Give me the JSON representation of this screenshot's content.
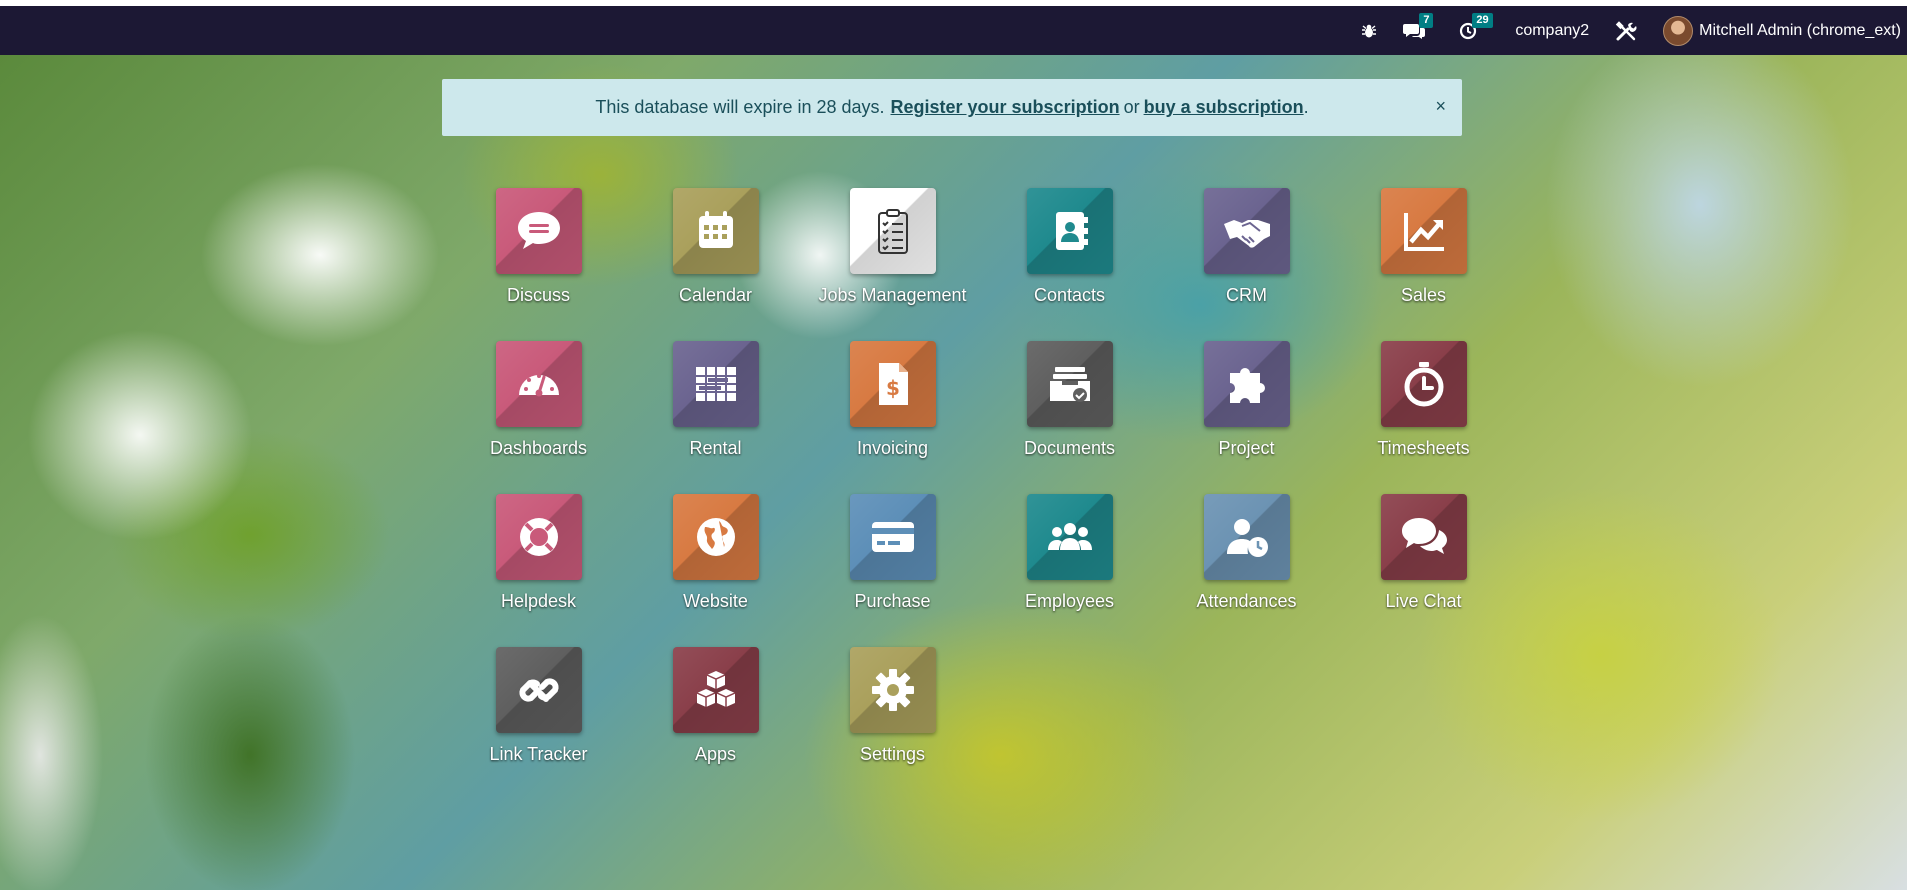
{
  "navbar": {
    "debug_icon": "bug-icon",
    "messages_count": "7",
    "activities_count": "29",
    "company": "company2",
    "tools_icon": "tools-icon",
    "user_name": "Mitchell Admin (chrome_ext)",
    "background_color": "#1c1834",
    "badge_color": "#017e84"
  },
  "notice": {
    "text_before": "This database will expire in 28 days.",
    "register_link": "Register your subscription",
    "or_text": "or",
    "buy_link": "buy a subscription",
    "end_text": ".",
    "close_label": "×",
    "background_color": "#cde8ec"
  },
  "apps": [
    {
      "label": "Discuss",
      "icon": "chat-bubble-icon",
      "color": "#c95a7a"
    },
    {
      "label": "Calendar",
      "icon": "calendar-icon",
      "color": "#aaa05c"
    },
    {
      "label": "Jobs Management",
      "icon": "clipboard-checklist-icon",
      "color": "#ffffff"
    },
    {
      "label": "Contacts",
      "icon": "address-book-icon",
      "color": "#1f8a8e"
    },
    {
      "label": "CRM",
      "icon": "handshake-icon",
      "color": "#6b6490"
    },
    {
      "label": "Sales",
      "icon": "trending-chart-icon",
      "color": "#d87a42"
    },
    {
      "label": "Dashboards",
      "icon": "gauge-icon",
      "color": "#c95a7a"
    },
    {
      "label": "Rental",
      "icon": "table-grid-icon",
      "color": "#6b6490"
    },
    {
      "label": "Invoicing",
      "icon": "invoice-dollar-icon",
      "color": "#d87a42"
    },
    {
      "label": "Documents",
      "icon": "inbox-tray-icon",
      "color": "#5f5f5f"
    },
    {
      "label": "Project",
      "icon": "puzzle-icon",
      "color": "#6b6490"
    },
    {
      "label": "Timesheets",
      "icon": "stopwatch-icon",
      "color": "#8a3f4a"
    },
    {
      "label": "Helpdesk",
      "icon": "lifebuoy-icon",
      "color": "#c95a7a"
    },
    {
      "label": "Website",
      "icon": "globe-icon",
      "color": "#d87a42"
    },
    {
      "label": "Purchase",
      "icon": "credit-card-icon",
      "color": "#5d8fb8"
    },
    {
      "label": "Employees",
      "icon": "people-group-icon",
      "color": "#1f8a8e"
    },
    {
      "label": "Attendances",
      "icon": "user-clock-icon",
      "color": "#6c93b3"
    },
    {
      "label": "Live Chat",
      "icon": "chat-bubbles-icon",
      "color": "#8a3f4a"
    },
    {
      "label": "Link Tracker",
      "icon": "link-icon",
      "color": "#5f5f5f"
    },
    {
      "label": "Apps",
      "icon": "cubes-icon",
      "color": "#8a3f4a"
    },
    {
      "label": "Settings",
      "icon": "gear-icon",
      "color": "#aaa05c"
    }
  ]
}
